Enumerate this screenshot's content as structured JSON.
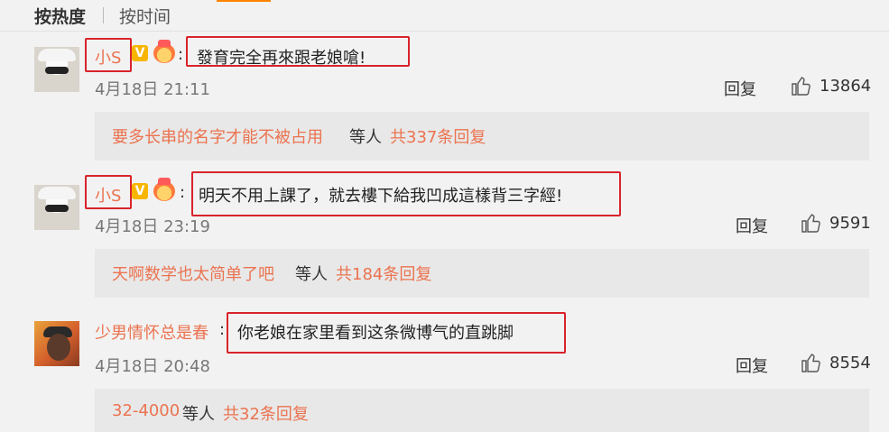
{
  "sort": {
    "hot": "按热度",
    "time": "按时间"
  },
  "comments": [
    {
      "author": "小S",
      "verified": "V",
      "text": "發育完全再來跟老娘嗆!",
      "time": "4月18日 21:11",
      "reply_label": "回复",
      "likes": "13864",
      "replies": {
        "users": "要多长串的名字才能不被占用",
        "etc": "等人",
        "count": "共337条回复"
      }
    },
    {
      "author": "小S",
      "verified": "V",
      "text": "明天不用上課了，就去樓下給我凹成這樣背三字經!",
      "time": "4月18日 23:19",
      "reply_label": "回复",
      "likes": "9591",
      "replies": {
        "users": "天啊数学也太简单了吧",
        "etc": "等人",
        "count": "共184条回复"
      }
    },
    {
      "author": "少男情怀总是春",
      "text": "你老娘在家里看到这条微博气的直跳脚",
      "time": "4月18日 20:48",
      "reply_label": "回复",
      "likes": "8554",
      "replies": {
        "users": "32-4000",
        "etc": "等人",
        "count": "共32条回复"
      }
    }
  ],
  "colors": {
    "link": "#eb7350",
    "highlight_box": "#d9232b",
    "accent": "#ff8200"
  }
}
